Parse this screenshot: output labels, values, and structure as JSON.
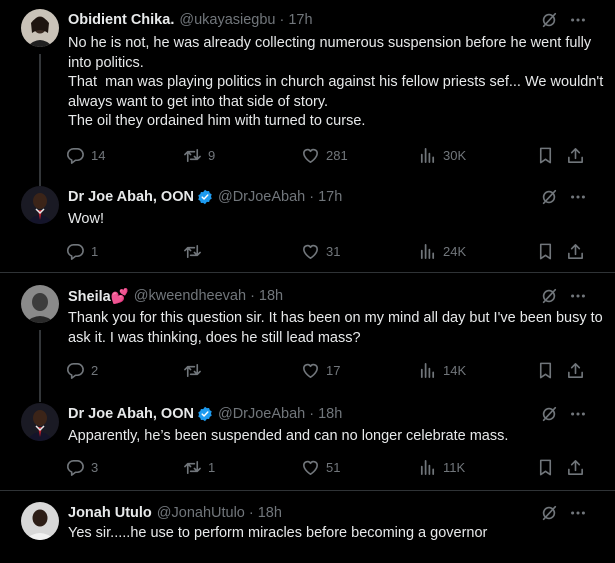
{
  "tweets": [
    {
      "name": "Obidient Chika.",
      "handle": "@ukayasiegbu",
      "time": "17h",
      "text": "No he is not, he was already collecting numerous suspension before he went fully into politics.\nThat  man was playing politics in church against his fellow priests sef... We wouldn't always want to get into that side of story.\nThe oil they ordained him with turned to curse.",
      "replies": "14",
      "retweets": "9",
      "likes": "281",
      "views": "30K",
      "verified": false
    },
    {
      "name": "Dr Joe Abah, OON",
      "handle": "@DrJoeAbah",
      "time": "17h",
      "text": "Wow!",
      "replies": "1",
      "retweets": "",
      "likes": "31",
      "views": "24K",
      "verified": true
    },
    {
      "name": "Sheila💕",
      "handle": "@kweendheevah",
      "time": "18h",
      "text": "Thank you for this question sir. It has been on my mind all day but I've been busy to ask it. I was thinking, does he still lead mass?",
      "replies": "2",
      "retweets": "",
      "likes": "17",
      "views": "14K",
      "verified": false
    },
    {
      "name": "Dr Joe Abah, OON",
      "handle": "@DrJoeAbah",
      "time": "18h",
      "text": "Apparently, he’s been suspended and can no longer celebrate mass.",
      "replies": "3",
      "retweets": "1",
      "likes": "51",
      "views": "11K",
      "verified": true
    },
    {
      "name": "Jonah Utulo",
      "handle": "@JonahUtulo",
      "time": "18h",
      "text": "Yes sir.....he use to perform miracles before becoming a governor",
      "replies": "",
      "retweets": "",
      "likes": "",
      "views": "",
      "verified": false
    }
  ],
  "separator": "·",
  "colors": {
    "background": "#000000",
    "text": "#e7e9ea",
    "muted": "#71767b",
    "verified": "#1d9bf0",
    "divider": "#2f3336"
  }
}
